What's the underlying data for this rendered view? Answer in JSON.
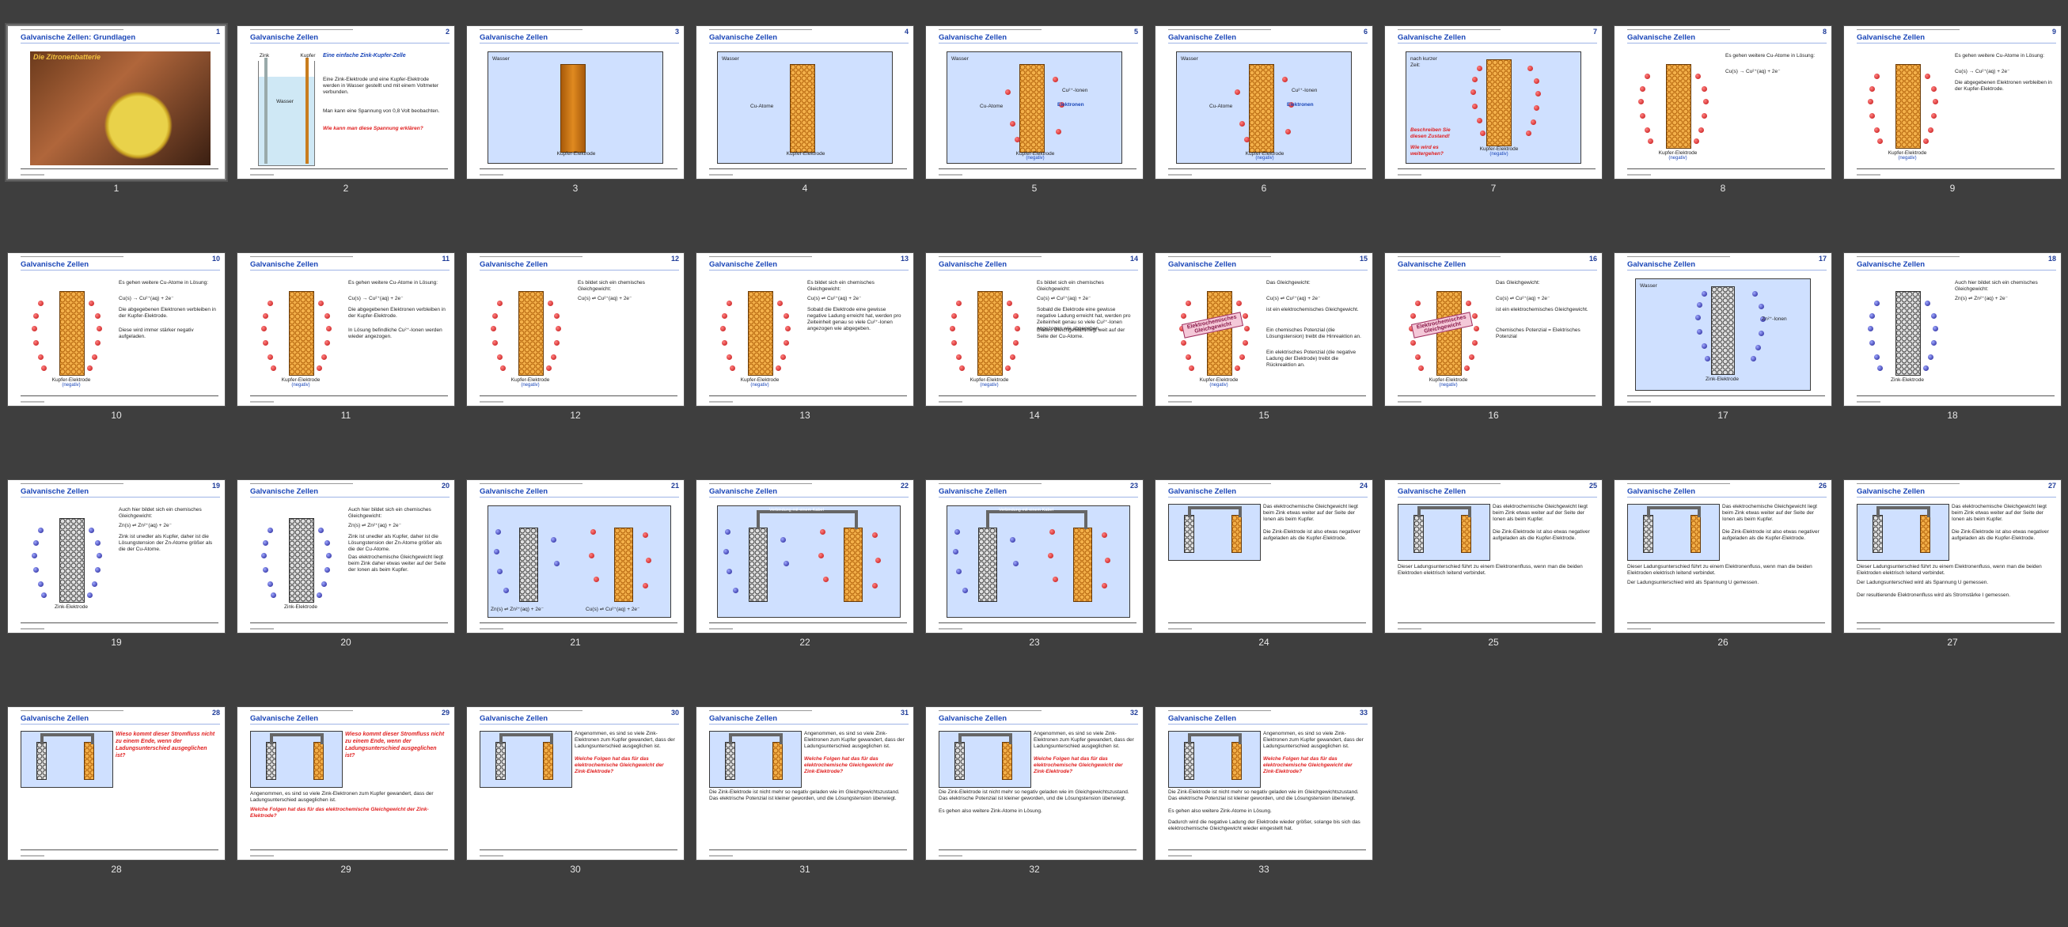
{
  "deck_title": "Galvanische Zellen: Grundlagen",
  "section_title": "Galvanische Zellen",
  "selected_slide": 1,
  "slides": [
    {
      "n": "1",
      "label": "1",
      "title": "Galvanische Zellen: Grundlagen",
      "photo_caption": "Die Zitronenbatterie"
    },
    {
      "n": "2",
      "label": "2",
      "title": "Galvanische Zellen",
      "head": "Eine einfache Zink-Kupfer-Zelle",
      "body": "Eine Zink-Elektrode und eine Kupfer-Elektrode werden in Wasser gestellt und mit einem Voltmeter verbunden.",
      "body2": "Man kann eine Spannung von 0,8 Volt beobachten.",
      "question": "Wie kann man diese Spannung erklären?",
      "zinc": "Zink",
      "copper": "Kupfer",
      "water": "Wasser"
    },
    {
      "n": "3",
      "label": "3",
      "title": "Galvanische Zellen",
      "water": "Wasser",
      "electrode": "Kupfer-Elektrode"
    },
    {
      "n": "4",
      "label": "4",
      "title": "Galvanische Zellen",
      "water": "Wasser",
      "atoms": "Cu-Atome",
      "electrode": "Kupfer-Elektrode"
    },
    {
      "n": "5",
      "label": "5",
      "title": "Galvanische Zellen",
      "water": "Wasser",
      "atoms": "Cu-Atome",
      "ions": "Cu²⁺-Ionen",
      "electrons": "Elektronen",
      "electrode": "Kupfer-Elektrode",
      "negative": "(negativ)"
    },
    {
      "n": "6",
      "label": "6",
      "title": "Galvanische Zellen",
      "water": "Wasser",
      "atoms": "Cu-Atome",
      "ions": "Cu²⁺-Ionen",
      "electrons": "Elektronen",
      "electrode": "Kupfer-Elektrode",
      "negative": "(negativ)"
    },
    {
      "n": "7",
      "label": "7",
      "title": "Galvanische Zellen",
      "intro": "nach kurzer Zeit:",
      "q1": "Beschreiben Sie diesen Zustand!",
      "q2": "Wie wird es weitergehen?",
      "electrode": "Kupfer-Elektrode",
      "negative": "(negativ)"
    },
    {
      "n": "8",
      "label": "8",
      "title": "Galvanische Zellen",
      "body": "Es gehen weitere Cu-Atome in Lösung:",
      "eq": "Cu(s) → Cu²⁺(aq) + 2e⁻",
      "electrode": "Kupfer-Elektrode",
      "negative": "(negativ)"
    },
    {
      "n": "9",
      "label": "9",
      "title": "Galvanische Zellen",
      "body": "Es gehen weitere Cu-Atome in Lösung:",
      "eq": "Cu(s) → Cu²⁺(aq) + 2e⁻",
      "body2": "Die abgegebenen Elektronen verbleiben in der Kupfer-Elektrode.",
      "electrode": "Kupfer-Elektrode",
      "negative": "(negativ)"
    },
    {
      "n": "10",
      "label": "10",
      "title": "Galvanische Zellen",
      "body": "Es gehen weitere Cu-Atome in Lösung:",
      "eq": "Cu(s) → Cu²⁺(aq) + 2e⁻",
      "body2": "Die abgegebenen Elektronen verbleiben in der Kupfer-Elektrode.",
      "body3": "Diese wird immer stärker negativ aufgeladen.",
      "electrode": "Kupfer-Elektrode",
      "negative": "(negativ)"
    },
    {
      "n": "11",
      "label": "11",
      "title": "Galvanische Zellen",
      "body": "Es gehen weitere Cu-Atome in Lösung:",
      "eq": "Cu(s) → Cu²⁺(aq) + 2e⁻",
      "body2": "Die abgegebenen Elektronen verbleiben in der Kupfer-Elektrode.",
      "body3": "In Lösung befindliche Cu²⁺-Ionen werden wieder angezogen.",
      "electrode": "Kupfer-Elektrode",
      "negative": "(negativ)"
    },
    {
      "n": "12",
      "label": "12",
      "title": "Galvanische Zellen",
      "body": "Es bildet sich ein chemisches Gleichgewicht:",
      "eq": "Cu(s) ⇌ Cu²⁺(aq) + 2e⁻",
      "electrode": "Kupfer-Elektrode",
      "negative": "(negativ)"
    },
    {
      "n": "13",
      "label": "13",
      "title": "Galvanische Zellen",
      "body": "Es bildet sich ein chemisches Gleichgewicht:",
      "eq": "Cu(s) ⇌ Cu²⁺(aq) + 2e⁻",
      "body2": "Sobald die Elektrode eine gewisse negative Ladung erreicht hat, werden pro Zeiteinheit genau so viele Cu²⁺-Ionen angezogen wie abgegeben.",
      "electrode": "Kupfer-Elektrode",
      "negative": "(negativ)"
    },
    {
      "n": "14",
      "label": "14",
      "title": "Galvanische Zellen",
      "body": "Es bildet sich ein chemisches Gleichgewicht:",
      "eq": "Cu(s) ⇌ Cu²⁺(aq) + 2e⁻",
      "body2": "Sobald die Elektrode eine gewisse negative Ladung erreicht hat, werden pro Zeiteinheit genau so viele Cu²⁺-Ionen angezogen wie abgegeben.",
      "body3": "Dieses Gleichgewicht liegt weit auf der Seite der Cu-Atome.",
      "electrode": "Kupfer-Elektrode",
      "negative": "(negativ)"
    },
    {
      "n": "15",
      "label": "15",
      "title": "Galvanische Zellen",
      "body": "Das Gleichgewicht:",
      "eq": "Cu(s) ⇌ Cu²⁺(aq) + 2e⁻",
      "body2": "ist ein elektrochemisches Gleichgewicht.",
      "body3": "Ein chemisches Potenzial (die Lösungstension) treibt die Hinreaktion an.",
      "body4": "Ein elektrisches Potenzial (die negative Ladung der Elektrode) treibt die Rückreaktion an.",
      "stamp": "Elektrochemisches Gleichgewicht",
      "electrode": "Kupfer-Elektrode",
      "negative": "(negativ)"
    },
    {
      "n": "16",
      "label": "16",
      "title": "Galvanische Zellen",
      "body": "Das Gleichgewicht:",
      "eq": "Cu(s) ⇌ Cu²⁺(aq) + 2e⁻",
      "body2": "ist ein elektrochemisches Gleichgewicht.",
      "body3": "Chemisches Potenzial = Elektrisches Potenzial",
      "stamp": "Elektrochemisches Gleichgewicht",
      "electrode": "Kupfer-Elektrode",
      "negative": "(negativ)"
    },
    {
      "n": "17",
      "label": "17",
      "title": "Galvanische Zellen",
      "water": "Wasser",
      "ions": "Zn²⁺-Ionen",
      "electrode": "Zink-Elektrode"
    },
    {
      "n": "18",
      "label": "18",
      "title": "Galvanische Zellen",
      "body": "Auch hier bildet sich ein chemisches Gleichgewicht:",
      "eq": "Zn(s) ⇌ Zn²⁺(aq) + 2e⁻",
      "electrode": "Zink-Elektrode"
    },
    {
      "n": "19",
      "label": "19",
      "title": "Galvanische Zellen",
      "body": "Auch hier bildet sich ein chemisches Gleichgewicht:",
      "eq": "Zn(s) ⇌ Zn²⁺(aq) + 2e⁻",
      "body2": "Zink ist unedler als Kupfer, daher ist die Lösungstension der Zn-Atome größer als die der Cu-Atome.",
      "electrode": "Zink-Elektrode"
    },
    {
      "n": "20",
      "label": "20",
      "title": "Galvanische Zellen",
      "body": "Auch hier bildet sich ein chemisches Gleichgewicht:",
      "eq": "Zn(s) ⇌ Zn²⁺(aq) + 2e⁻",
      "body2": "Zink ist unedler als Kupfer, daher ist die Lösungstension der Zn-Atome größer als die der Cu-Atome.",
      "body3": "Das elektrochemische Gleichgewicht liegt beim Zink daher etwas weiter auf der Seite der Ionen als beim Kupfer.",
      "electrode": "Zink-Elektrode"
    },
    {
      "n": "21",
      "label": "21",
      "title": "Galvanische Zellen",
      "eq_zn": "Zn(s) ⇌ Zn²⁺(aq) + 2e⁻",
      "eq_cu": "Cu(s) ⇌ Cu²⁺(aq) + 2e⁻"
    },
    {
      "n": "22",
      "label": "22",
      "title": "Galvanische Zellen",
      "wire": "Verbindung mit einem Kabel"
    },
    {
      "n": "23",
      "label": "23",
      "title": "Galvanische Zellen",
      "wire": "Verbindung mit einem Kabel"
    },
    {
      "n": "24",
      "label": "24",
      "title": "Galvanische Zellen",
      "body": "Das elektrochemische Gleichgewicht liegt beim Zink etwas weiter auf der Seite der Ionen als beim Kupfer.",
      "body2": "Die Zink-Elektrode ist also etwas negativer aufgeladen als die Kupfer-Elektrode."
    },
    {
      "n": "25",
      "label": "25",
      "title": "Galvanische Zellen",
      "body": "Das elektrochemische Gleichgewicht liegt beim Zink etwas weiter auf der Seite der Ionen als beim Kupfer.",
      "body2": "Die Zink-Elektrode ist also etwas negativer aufgeladen als die Kupfer-Elektrode.",
      "body3": "Dieser Ladungsunterschied führt zu einem Elektronenfluss, wenn man die beiden Elektroden elektrisch leitend verbindet."
    },
    {
      "n": "26",
      "label": "26",
      "title": "Galvanische Zellen",
      "body": "Das elektrochemische Gleichgewicht liegt beim Zink etwas weiter auf der Seite der Ionen als beim Kupfer.",
      "body2": "Die Zink-Elektrode ist also etwas negativer aufgeladen als die Kupfer-Elektrode.",
      "body3": "Dieser Ladungsunterschied führt zu einem Elektronenfluss, wenn man die beiden Elektroden elektrisch leitend verbindet.",
      "body4": "Der Ladungsunterschied wird als Spannung U gemessen."
    },
    {
      "n": "27",
      "label": "27",
      "title": "Galvanische Zellen",
      "body": "Das elektrochemische Gleichgewicht liegt beim Zink etwas weiter auf der Seite der Ionen als beim Kupfer.",
      "body2": "Die Zink-Elektrode ist also etwas negativer aufgeladen als die Kupfer-Elektrode.",
      "body3": "Dieser Ladungsunterschied führt zu einem Elektronenfluss, wenn man die beiden Elektroden elektrisch leitend verbindet.",
      "body4": "Der Ladungsunterschied wird als Spannung U gemessen.",
      "body5": "Der resultierende Elektronenfluss wird als Stromstärke I gemessen."
    },
    {
      "n": "28",
      "label": "28",
      "title": "Galvanische Zellen",
      "question": "Wieso kommt dieser Stromfluss nicht zu einem Ende, wenn der Ladungsunterschied ausgeglichen ist?"
    },
    {
      "n": "29",
      "label": "29",
      "title": "Galvanische Zellen",
      "question": "Wieso kommt dieser Stromfluss nicht zu einem Ende, wenn der Ladungsunterschied ausgeglichen ist?",
      "body": "Angenommen, es sind so viele Zink-Elektronen zum Kupfer gewandert, dass der Ladungsunterschied ausgeglichen ist.",
      "question2": "Welche Folgen hat das für das elektrochemische Gleichgewicht der Zink-Elektrode?"
    },
    {
      "n": "30",
      "label": "30",
      "title": "Galvanische Zellen",
      "body": "Angenommen, es sind so viele Zink-Elektronen zum Kupfer gewandert, dass der Ladungsunterschied ausgeglichen ist.",
      "question2": "Welche Folgen hat das für das elektrochemische Gleichgewicht der Zink-Elektrode?"
    },
    {
      "n": "31",
      "label": "31",
      "title": "Galvanische Zellen",
      "body": "Angenommen, es sind so viele Zink-Elektronen zum Kupfer gewandert, dass der Ladungsunterschied ausgeglichen ist.",
      "question2": "Welche Folgen hat das für das elektrochemische Gleichgewicht der Zink-Elektrode?",
      "body2": "Die Zink-Elektrode ist nicht mehr so negativ geladen wie im Gleichgewichtszustand. Das elektrische Potenzial ist kleiner geworden, und die Lösungstension überwiegt."
    },
    {
      "n": "32",
      "label": "32",
      "title": "Galvanische Zellen",
      "body": "Angenommen, es sind so viele Zink-Elektronen zum Kupfer gewandert, dass der Ladungsunterschied ausgeglichen ist.",
      "question2": "Welche Folgen hat das für das elektrochemische Gleichgewicht der Zink-Elektrode?",
      "body2": "Die Zink-Elektrode ist nicht mehr so negativ geladen wie im Gleichgewichtszustand. Das elektrische Potenzial ist kleiner geworden, und die Lösungstension überwiegt.",
      "body3": "Es gehen also weitere Zink-Atome in Lösung."
    },
    {
      "n": "33",
      "label": "33",
      "title": "Galvanische Zellen",
      "body": "Angenommen, es sind so viele Zink-Elektronen zum Kupfer gewandert, dass der Ladungsunterschied ausgeglichen ist.",
      "question2": "Welche Folgen hat das für das elektrochemische Gleichgewicht der Zink-Elektrode?",
      "body2": "Die Zink-Elektrode ist nicht mehr so negativ geladen wie im Gleichgewichtszustand. Das elektrische Potenzial ist kleiner geworden, und die Lösungstension überwiegt.",
      "body3": "Es gehen also weitere Zink-Atome in Lösung.",
      "body4": "Dadurch wird die negative Ladung der Elektrode wieder größer, solange bis sich das elektrochemische Gleichgewicht wieder eingestellt hat."
    }
  ]
}
